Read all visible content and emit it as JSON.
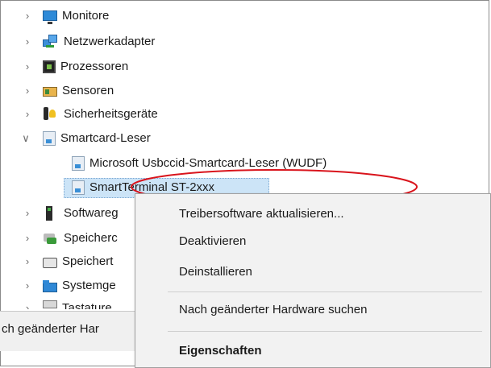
{
  "tree": {
    "items": [
      {
        "label": "Monitore",
        "icon": "monitor-icon",
        "expanded": false
      },
      {
        "label": "Netzwerkadapter",
        "icon": "network-adapter-icon",
        "expanded": false
      },
      {
        "label": "Prozessoren",
        "icon": "processor-icon",
        "expanded": false
      },
      {
        "label": "Sensoren",
        "icon": "sensor-icon",
        "expanded": false
      },
      {
        "label": "Sicherheitsgeräte",
        "icon": "security-device-icon",
        "expanded": false
      },
      {
        "label": "Smartcard-Leser",
        "icon": "smartcard-reader-icon",
        "expanded": true
      },
      {
        "label": "Microsoft Usbccid-Smartcard-Leser (WUDF)",
        "icon": "smartcard-reader-icon"
      },
      {
        "label": "SmartTerminal ST-2xxx",
        "icon": "smartcard-reader-icon",
        "selected": true
      },
      {
        "label": "Softwareg",
        "icon": "software-device-icon",
        "expanded": false
      },
      {
        "label": "Speicherc",
        "icon": "storage-controller-icon",
        "expanded": false
      },
      {
        "label": "Speichert",
        "icon": "storage-volume-icon",
        "expanded": false
      },
      {
        "label": "Systemge",
        "icon": "system-device-icon",
        "expanded": false
      },
      {
        "label": "Tastature",
        "icon": "keyboard-icon",
        "expanded": false
      }
    ]
  },
  "context_menu": {
    "items": [
      {
        "label": "Treibersoftware aktualisieren..."
      },
      {
        "label": "Deaktivieren"
      },
      {
        "label": "Deinstallieren"
      },
      {
        "label": "Nach geänderter Hardware suchen"
      },
      {
        "label": "Eigenschaften"
      }
    ]
  },
  "status_bar": {
    "text": "ch geänderter Har"
  },
  "colors": {
    "selection": "#cce4f7",
    "annotation": "#d9141c",
    "menu_bg": "#f2f2f2"
  }
}
